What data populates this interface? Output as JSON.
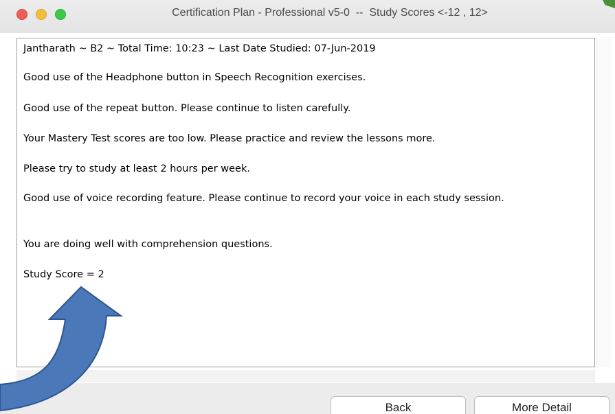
{
  "window": {
    "title": "Certification Plan - Professional v5-0  --  Study Scores <-12 , 12>"
  },
  "report": {
    "header": "Jantharath  ~  B2   ~  Total Time: 10:23  ~  Last Date Studied: 07-Jun-2019",
    "lines": [
      "Good use of the Headphone button in Speech Recognition exercises.",
      "Good use of the repeat button.  Please continue to listen carefully.",
      "Your Mastery Test scores are too low.  Please practice and review the lessons more.",
      "Please try to study at least 2 hours per week.",
      "Good use of voice recording feature.  Please continue to record your voice in each study session.",
      "You are doing well with comprehension questions.",
      "Study Score = 2"
    ]
  },
  "buttons": {
    "back": "Back",
    "more_detail": "More Detail"
  },
  "colors": {
    "arrow_fill": "#4a78b8",
    "arrow_stroke": "#2f5590",
    "close": "#ee5e55",
    "minimize": "#f4be3c",
    "zoom": "#3bc94a"
  }
}
